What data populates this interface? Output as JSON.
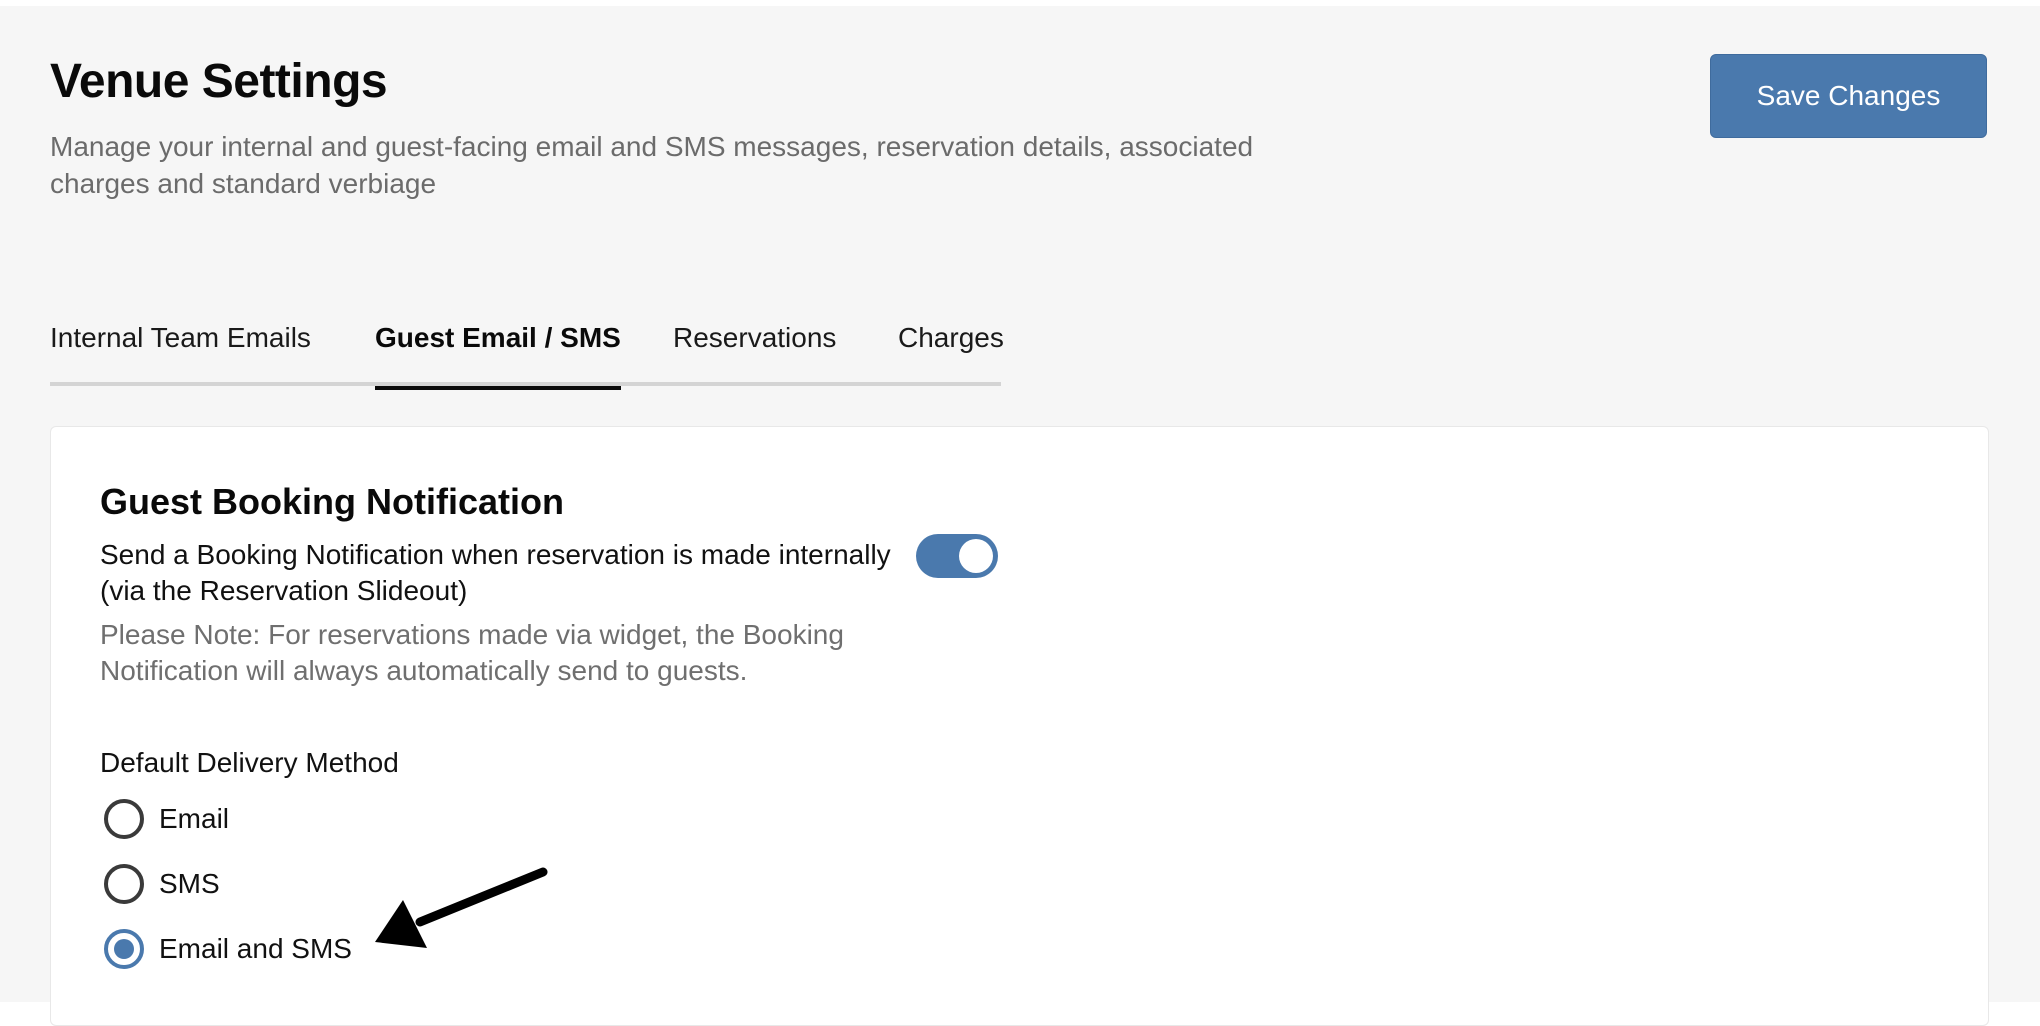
{
  "header": {
    "title": "Venue Settings",
    "description": "Manage your internal and guest-facing email and SMS messages, reservation details, associated charges and standard verbiage",
    "save_label": "Save Changes"
  },
  "tabs": [
    {
      "label": "Internal Team Emails",
      "active": false
    },
    {
      "label": "Guest Email / SMS",
      "active": true
    },
    {
      "label": "Reservations",
      "active": false
    },
    {
      "label": "Charges",
      "active": false
    }
  ],
  "guest_booking": {
    "title": "Guest Booking Notification",
    "toggle_text": "Send a Booking Notification when reservation is made internally (via the Reservation Slideout)",
    "toggle_on": true,
    "note": "Please Note: For reservations made via widget, the Booking Notification will always automatically send to guests.",
    "delivery_label": "Default Delivery Method",
    "delivery_options": [
      {
        "label": "Email",
        "selected": false
      },
      {
        "label": "SMS",
        "selected": false
      },
      {
        "label": "Email and SMS",
        "selected": true
      }
    ]
  },
  "colors": {
    "accent": "#4a79ad",
    "background": "#f6f6f6",
    "muted_text": "#6b6b6b"
  },
  "annotation": {
    "icon": "arrow-icon",
    "points_to": "Email and SMS"
  }
}
